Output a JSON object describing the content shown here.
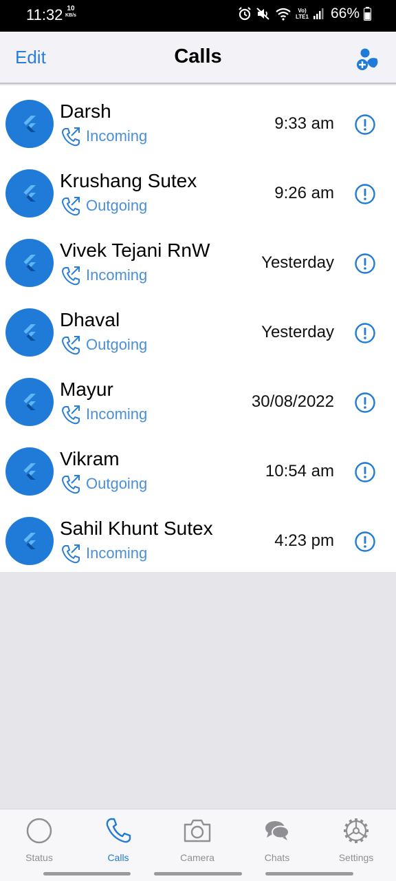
{
  "status_bar": {
    "time": "11:32",
    "speed_value": "10",
    "speed_unit": "KB/s",
    "network_label_top": "Vo)",
    "network_label_bottom": "LTE1",
    "battery": "66%"
  },
  "nav": {
    "edit_label": "Edit",
    "title": "Calls"
  },
  "calls": [
    {
      "name": "Darsh",
      "type": "Incoming",
      "time": "9:33 am"
    },
    {
      "name": "Krushang Sutex",
      "type": "Outgoing",
      "time": "9:26 am"
    },
    {
      "name": "Vivek Tejani RnW",
      "type": "Incoming",
      "time": "Yesterday"
    },
    {
      "name": "Dhaval",
      "type": "Outgoing",
      "time": "Yesterday"
    },
    {
      "name": "Mayur",
      "type": "Incoming",
      "time": "30/08/2022"
    },
    {
      "name": "Vikram",
      "type": "Outgoing",
      "time": "10:54 am"
    },
    {
      "name": "Sahil Khunt Sutex",
      "type": "Incoming",
      "time": "4:23 pm"
    }
  ],
  "tabs": [
    {
      "label": "Status",
      "icon": "circle-icon",
      "active": false
    },
    {
      "label": "Calls",
      "icon": "phone-icon",
      "active": true
    },
    {
      "label": "Camera",
      "icon": "camera-icon",
      "active": false
    },
    {
      "label": "Chats",
      "icon": "chat-bubbles-icon",
      "active": false
    },
    {
      "label": "Settings",
      "icon": "gear-icon",
      "active": false
    }
  ],
  "colors": {
    "accent": "#1f7ad8",
    "sub_text": "#4a8fd8",
    "background": "#e5e5ea",
    "inactive_tab": "#8e8e93"
  }
}
